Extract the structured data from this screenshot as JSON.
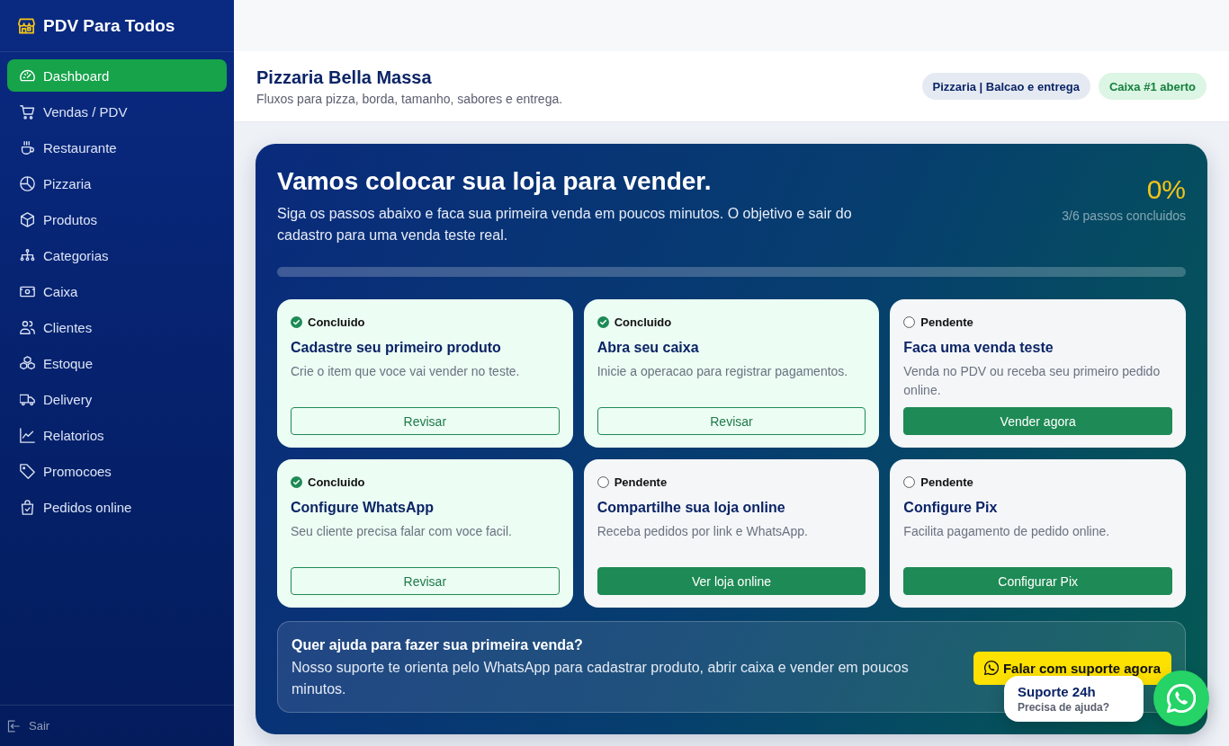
{
  "sidebar": {
    "brand": "PDV Para Todos",
    "items": [
      {
        "label": "Dashboard",
        "selected": true
      },
      {
        "label": "Vendas / PDV",
        "selected": false
      },
      {
        "label": "Restaurante",
        "selected": false
      },
      {
        "label": "Pizzaria",
        "selected": false
      },
      {
        "label": "Produtos",
        "selected": false
      },
      {
        "label": "Categorias",
        "selected": false
      },
      {
        "label": "Caixa",
        "selected": false
      },
      {
        "label": "Clientes",
        "selected": false
      },
      {
        "label": "Estoque",
        "selected": false
      },
      {
        "label": "Delivery",
        "selected": false
      },
      {
        "label": "Relatorios",
        "selected": false
      },
      {
        "label": "Promocoes",
        "selected": false
      },
      {
        "label": "Pedidos online",
        "selected": false
      }
    ],
    "logout": "Sair"
  },
  "header": {
    "title": "Pizzaria Bella Massa",
    "subtitle": "Fluxos para pizza, borda, tamanho, sabores e entrega.",
    "badges": [
      {
        "label": "Pizzaria | Balcao e entrega",
        "kind": "neutral"
      },
      {
        "label": "Caixa #1 aberto",
        "kind": "success"
      }
    ]
  },
  "hero": {
    "title": "Vamos colocar sua loja para vender.",
    "description": "Siga os passos abaixo e faca sua primeira venda em poucos minutos. O objetivo e sair do cadastro para uma venda teste real.",
    "percent": "0%",
    "steps_done": "3/6 passos concluidos",
    "steps": [
      {
        "status": "Concluido",
        "done": true,
        "title": "Cadastre seu primeiro produto",
        "description": "Crie o item que voce vai vender no teste.",
        "button": "Revisar"
      },
      {
        "status": "Concluido",
        "done": true,
        "title": "Abra seu caixa",
        "description": "Inicie a operacao para registrar pagamentos.",
        "button": "Revisar"
      },
      {
        "status": "Pendente",
        "done": false,
        "title": "Faca uma venda teste",
        "description": "Venda no PDV ou receba seu primeiro pedido online.",
        "button": "Vender agora"
      },
      {
        "status": "Concluido",
        "done": true,
        "title": "Configure WhatsApp",
        "description": "Seu cliente precisa falar com voce facil.",
        "button": "Revisar"
      },
      {
        "status": "Pendente",
        "done": false,
        "title": "Compartilhe sua loja online",
        "description": "Receba pedidos por link e WhatsApp.",
        "button": "Ver loja online"
      },
      {
        "status": "Pendente",
        "done": false,
        "title": "Configure Pix",
        "description": "Facilita pagamento de pedido online.",
        "button": "Configurar Pix"
      }
    ],
    "help": {
      "title": "Quer ajuda para fazer sua primeira venda?",
      "text": "Nosso suporte te orienta pelo WhatsApp para cadastrar produto, abrir caixa e vender em poucos minutos.",
      "button": "Falar com suporte agora"
    }
  },
  "support_widget": {
    "title": "Suporte 24h",
    "subtitle": "Precisa de ajuda?"
  }
}
